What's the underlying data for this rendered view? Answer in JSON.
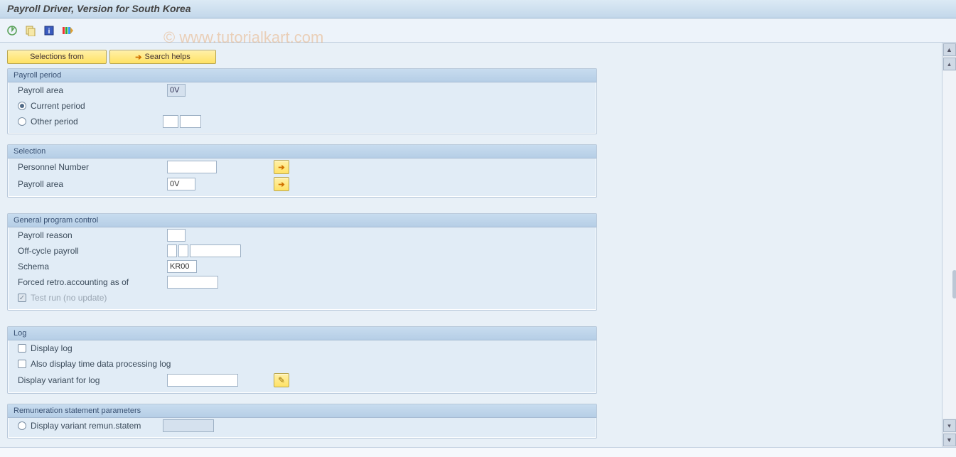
{
  "title": "Payroll Driver, Version for South Korea",
  "watermark": "© www.tutorialkart.com",
  "toolbar": {
    "icons": [
      "execute-icon",
      "get-variant-icon",
      "info-icon",
      "selection-options-icon"
    ]
  },
  "actions": {
    "selections_from": "Selections from",
    "search_helps": "Search helps"
  },
  "payroll_period": {
    "group_title": "Payroll period",
    "payroll_area_label": "Payroll area",
    "payroll_area_value": "0V",
    "current_period_label": "Current period",
    "other_period_label": "Other period",
    "selected": "current",
    "other_period_a": "",
    "other_period_b": ""
  },
  "selection": {
    "group_title": "Selection",
    "personnel_number_label": "Personnel Number",
    "personnel_number_value": "",
    "payroll_area_label": "Payroll area",
    "payroll_area_value": "0V"
  },
  "general": {
    "group_title": "General program control",
    "payroll_reason_label": "Payroll reason",
    "payroll_reason_value": "",
    "offcycle_label": "Off-cycle payroll",
    "offcycle_a": "",
    "offcycle_b": "",
    "offcycle_c": "",
    "schema_label": "Schema",
    "schema_value": "KR00",
    "forced_retro_label": "Forced retro.accounting as of",
    "forced_retro_value": "",
    "test_run_label": "Test run (no update)",
    "test_run_checked": true
  },
  "log": {
    "group_title": "Log",
    "display_log_label": "Display log",
    "time_log_label": "Also display time data processing log",
    "variant_label": "Display variant for log",
    "variant_value": ""
  },
  "remun": {
    "group_title": "Remuneration statement parameters",
    "display_variant_label": "Display variant remun.statem",
    "variant_value": ""
  }
}
